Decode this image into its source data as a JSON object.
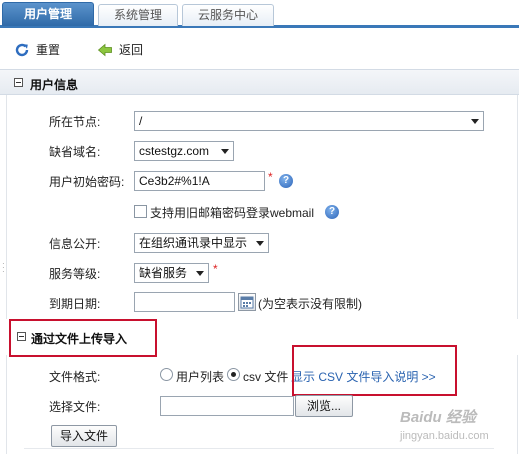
{
  "tabs": {
    "user_mgmt": "用户管理",
    "sys_mgmt": "系统管理",
    "cloud": "云服务中心"
  },
  "toolbar": {
    "reset": "重置",
    "back": "返回"
  },
  "user_info": {
    "title": "用户信息",
    "node_label": "所在节点:",
    "node_value": "/",
    "domain_label": "缺省域名:",
    "domain_value": "cstestgz.com",
    "password_label": "用户初始密码:",
    "password_value": "Ce3b2#%1!A",
    "required_mark": "*",
    "help_glyph": "?",
    "old_pwd_checkbox_label": "支持用旧邮箱密码登录webmail",
    "publish_label": "信息公开:",
    "publish_value": "在组织通讯录中显示",
    "service_label": "服务等级:",
    "service_value": "缺省服务",
    "expire_label": "到期日期:",
    "expire_value": "",
    "expire_hint": "(为空表示没有限制)"
  },
  "import": {
    "title": "通过文件上传导入",
    "format_label": "文件格式:",
    "format_options": [
      "用户列表",
      "csv 文件"
    ],
    "selected_format": "csv 文件",
    "csv_help_link": "显示 CSV 文件导入说明 >>",
    "file_label": "选择文件:",
    "browse_button": "浏览...",
    "import_button": "导入文件"
  },
  "watermark": {
    "text": "Baidu 经验",
    "url": "jingyan.baidu.com"
  },
  "colors": {
    "tab_active": "#2f6aa8",
    "highlight_box": "#c8102e",
    "link": "#2a63b0"
  }
}
